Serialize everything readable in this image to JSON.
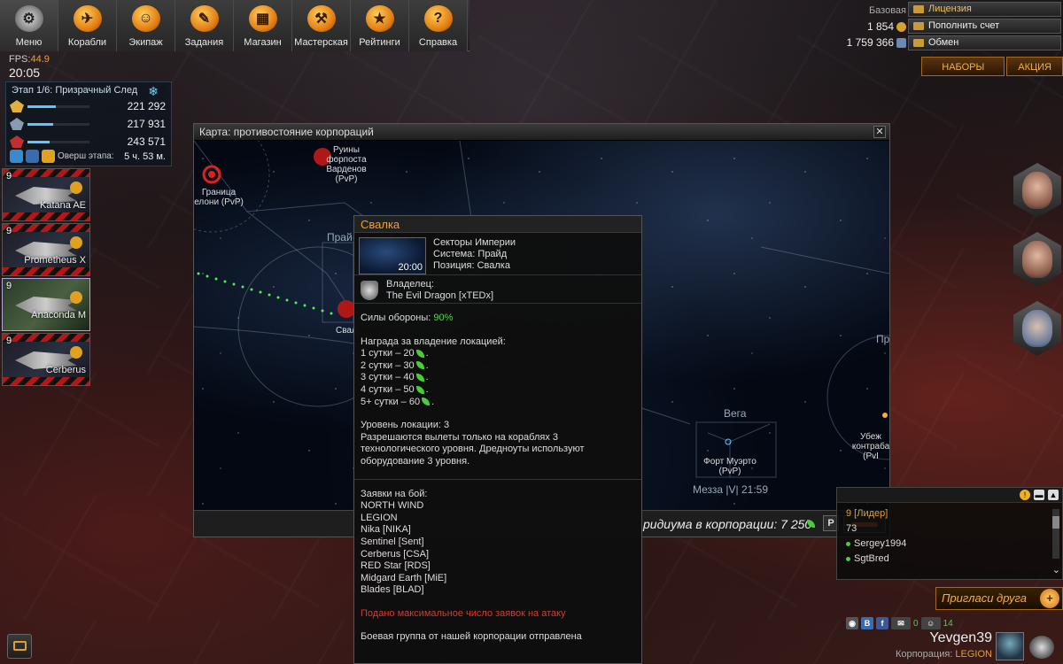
{
  "topbar": {
    "items": [
      {
        "label": "Меню",
        "icon": "gear-icon",
        "glyph": "⚙"
      },
      {
        "label": "Корабли",
        "icon": "ships-icon",
        "glyph": "✈"
      },
      {
        "label": "Экипаж",
        "icon": "crew-icon",
        "glyph": "☺"
      },
      {
        "label": "Задания",
        "icon": "tasks-icon",
        "glyph": "✎"
      },
      {
        "label": "Магазин",
        "icon": "shop-icon",
        "glyph": "▦"
      },
      {
        "label": "Мастерская",
        "icon": "workshop-icon",
        "glyph": "⚒"
      },
      {
        "label": "Рейтинги",
        "icon": "ratings-icon",
        "glyph": "★"
      },
      {
        "label": "Справка",
        "icon": "help-icon",
        "glyph": "?"
      }
    ]
  },
  "currency": {
    "base_label": "Базовая",
    "gold": "1 854",
    "credits": "1 759 366",
    "license_label": "Лицензия",
    "topup_label": "Пополнить счет",
    "exchange_label": "Обмен"
  },
  "promo": {
    "nabory": "НАБОРЫ",
    "akciya": "АКЦИЯ"
  },
  "hud": {
    "fps_label": "FPS:",
    "fps_value": "44.9",
    "clock": "20:05",
    "stage_title": "Этап 1/6: Призрачный След",
    "bars": [
      {
        "value": "221 292",
        "fill": 0.45
      },
      {
        "value": "217 931",
        "fill": 0.42
      },
      {
        "value": "243 571",
        "fill": 0.35
      }
    ],
    "stage_left_text": "Оверш    этапа:",
    "stage_time": "5 ч. 53 м."
  },
  "ships": [
    {
      "level": "9",
      "name": "Katana AE"
    },
    {
      "level": "9",
      "name": "Prometheus X"
    },
    {
      "level": "9",
      "name": "Anaconda M"
    },
    {
      "level": "9",
      "name": "Cerberus"
    }
  ],
  "map": {
    "title": "Карта: противостояние корпораций",
    "labels": {
      "ruins": "Руины\nфорпоста\nВарденов\n(PvP)",
      "border": "Граница\nелони (PvP)",
      "prai": "Прай",
      "svalka_short": "Свал",
      "vega": "Вега",
      "fort": "Форт Муэрто\n(PvP)",
      "messa": "Мезза |V| 21:59",
      "pro": "Про",
      "ubezh": "Убеж\nконтраба\n(PvI"
    },
    "bottom_text": "ридиума в корпорации: 7 250",
    "p_label": "P"
  },
  "popup": {
    "title": "Свалка",
    "thumb_time": "20:00",
    "sector": "Секторы Империи",
    "system": "Система: Прайд",
    "position": "Позиция: Свалка",
    "owner_label": "Владелец:",
    "owner_name": "The Evil Dragon [xTEDx]",
    "defense_label": "Силы обороны:",
    "defense_value": "90%",
    "reward_title": "Награда за владение локацией:",
    "rewards": [
      {
        "days": "1 сутки – 20",
        "value": 20
      },
      {
        "days": "2 сутки – 30",
        "value": 30
      },
      {
        "days": "3 сутки – 40",
        "value": 40
      },
      {
        "days": "4 сутки – 50",
        "value": 50
      },
      {
        "days": "5+ сутки – 60",
        "value": 60
      }
    ],
    "level_label": "Уровень локации:",
    "level_value": "3",
    "allowed_line1": "Разрешаются вылеты только на кораблях 3",
    "allowed_line2": "технологического уровня. Дредноуты используют",
    "allowed_line3": "оборудование 3 уровня.",
    "bids_title": "Заявки на бой:",
    "bids": [
      "NORTH WIND",
      "LEGION",
      "Nika [NIKA]",
      "Sentinel [Sent]",
      "Cerberus [CSA]",
      "RED Star [RDS]",
      "Midgard Earth [MiE]",
      "Blades [BLAD]"
    ],
    "warning": "Подано максимальное число заявок на атаку",
    "group_sent": "Боевая группа от нашей корпорации отправлена"
  },
  "chat": {
    "lines": [
      {
        "text": "9 [Лидер]",
        "leader": true
      },
      {
        "text": "73",
        "leader": false
      },
      {
        "text": "Sergey1994",
        "leader": false,
        "online": true
      },
      {
        "text": "SgtBred",
        "leader": false,
        "online": true
      }
    ]
  },
  "invite": {
    "label": "Пригласи друга",
    "plus": "+"
  },
  "user": {
    "name": "Yevgen39",
    "corp_label": "Корпорация:",
    "corp_name": "LEGION",
    "counter_a": "0",
    "counter_b": "14"
  },
  "colors": {
    "accent": "#f0a030",
    "green": "#58d14a",
    "warning": "#d83a2a",
    "bar": "#5ac8ff"
  }
}
